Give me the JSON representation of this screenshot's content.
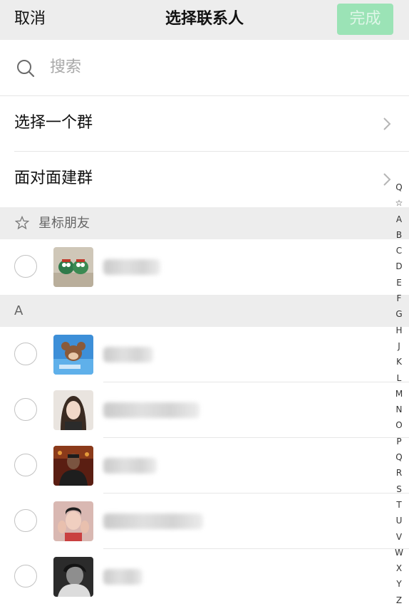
{
  "header": {
    "cancel_label": "取消",
    "title": "选择联系人",
    "done_label": "完成",
    "done_bg": "#9be3b6"
  },
  "search": {
    "placeholder": "搜索",
    "icon": "search-icon"
  },
  "menu": {
    "items": [
      {
        "label": "选择一个群",
        "icon": "chevron-right-icon"
      },
      {
        "label": "面对面建群",
        "icon": "chevron-right-icon"
      }
    ]
  },
  "sections": [
    {
      "title": "星标朋友",
      "icon": "star-icon",
      "contacts": [
        {
          "avatar": "avatar-toys",
          "name_hidden": true
        }
      ]
    },
    {
      "title": "A",
      "contacts": [
        {
          "avatar": "avatar-cartoon-mouse",
          "name_hidden": true
        },
        {
          "avatar": "avatar-woman-portrait",
          "name_hidden": true
        },
        {
          "avatar": "avatar-man-dark",
          "name_hidden": true
        },
        {
          "avatar": "avatar-man-hands",
          "name_hidden": true
        },
        {
          "avatar": "avatar-blurred-person",
          "name_hidden": true
        }
      ]
    }
  ],
  "alpha_index": [
    "Q",
    "☆",
    "A",
    "B",
    "C",
    "D",
    "E",
    "F",
    "G",
    "H",
    "J",
    "K",
    "L",
    "M",
    "N",
    "O",
    "P",
    "Q",
    "R",
    "S",
    "T",
    "U",
    "V",
    "W",
    "X",
    "Y",
    "Z"
  ],
  "colors": {
    "header_bg": "#ededed",
    "section_bg": "#ededed",
    "checkbox_border": "#c2c2c2"
  }
}
